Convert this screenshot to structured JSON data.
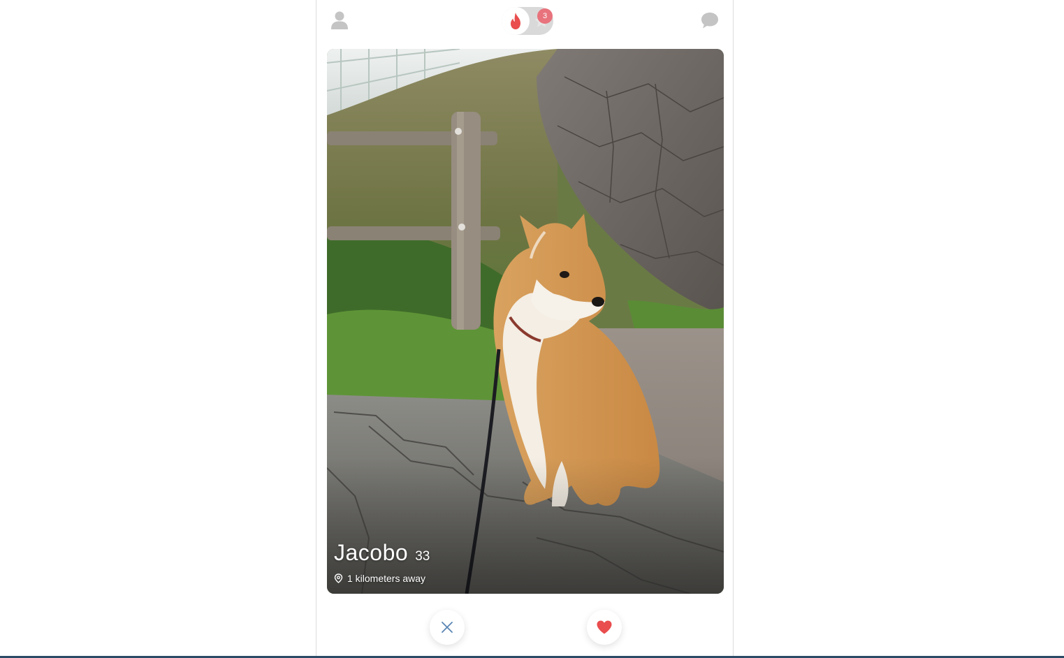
{
  "header": {
    "profile_icon": "person-icon",
    "chat_icon": "chat-bubble-icon",
    "toggle": {
      "active_icon": "flame-icon",
      "inactive_icon": "star-icon",
      "badge_count": "3"
    }
  },
  "card": {
    "name": "Jacobo",
    "age": "33",
    "distance": "1 kilometers away",
    "location_icon": "location-pin-icon"
  },
  "actions": {
    "nope_icon": "close-icon",
    "like_icon": "heart-icon"
  },
  "colors": {
    "accent": "#e94d4d",
    "badge": "#e8737d",
    "icon_gray": "#c4c4c4",
    "nope_blue": "#5a86b3",
    "frame_line": "#2b4a66"
  }
}
